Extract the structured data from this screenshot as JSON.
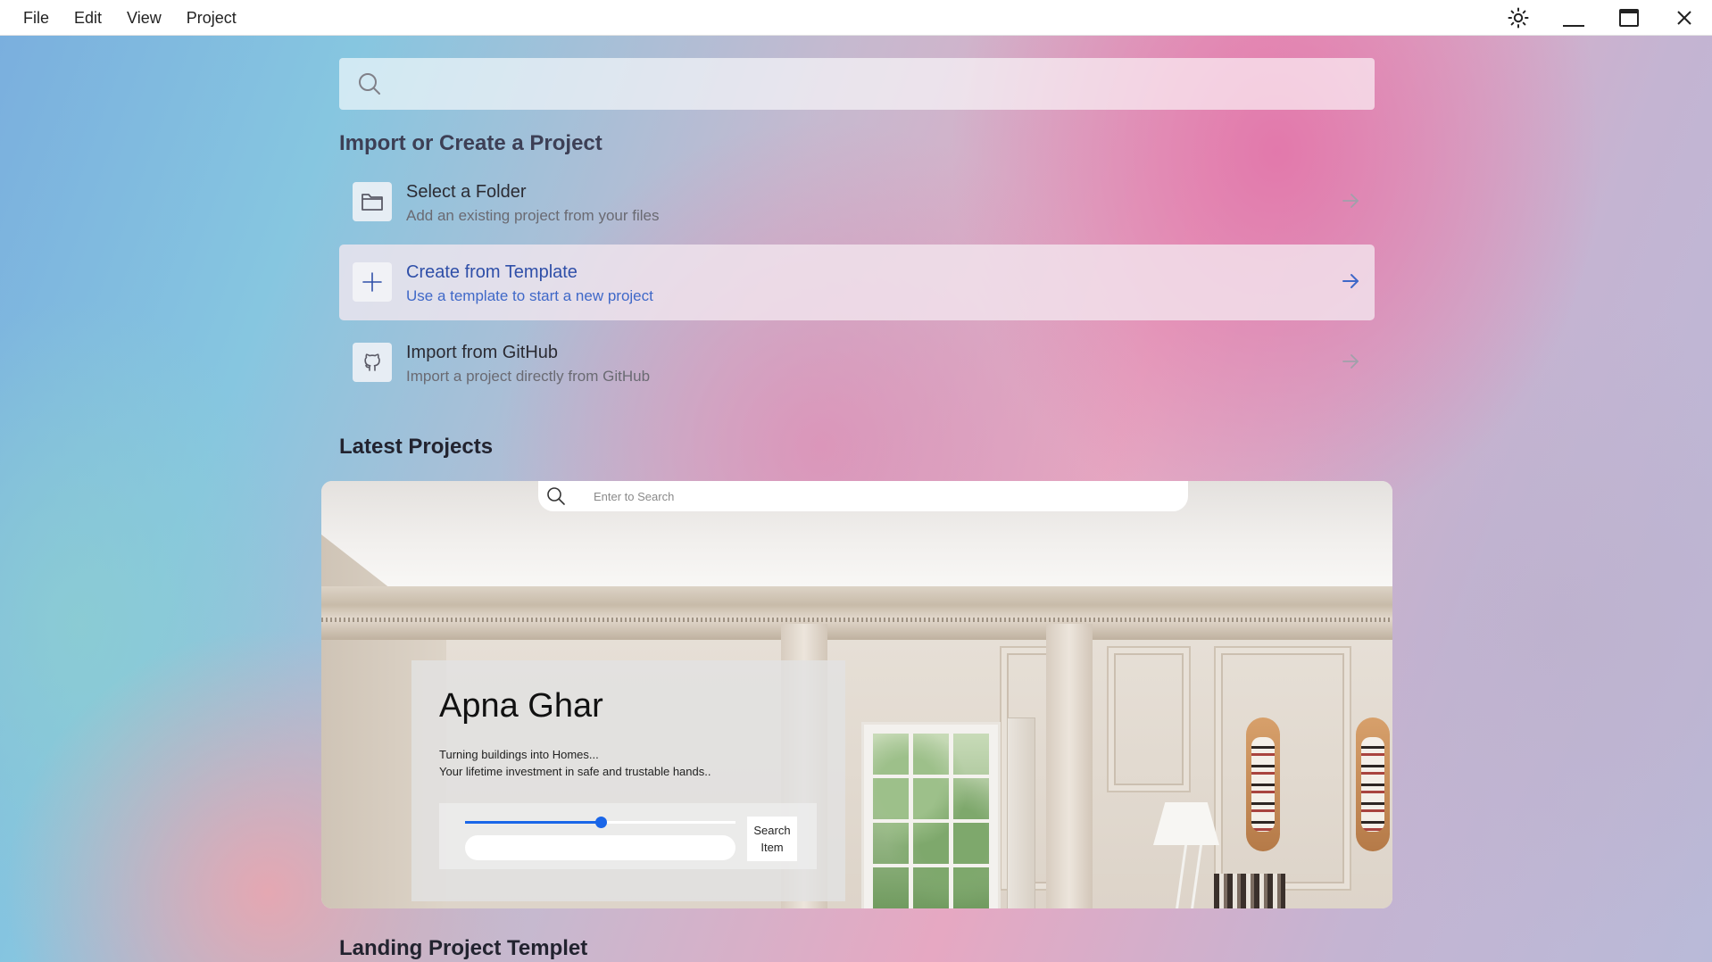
{
  "menu": {
    "items": [
      "File",
      "Edit",
      "View",
      "Project"
    ]
  },
  "window_controls": {
    "theme_icon": "sun-icon",
    "minimize_icon": "minimize-icon",
    "maximize_icon": "maximize-icon",
    "close_icon": "close-icon"
  },
  "search": {
    "placeholder": "",
    "value": ""
  },
  "import_section": {
    "title": "Import or Create a Project",
    "options": [
      {
        "title": "Select a Folder",
        "subtitle": "Add an existing project from your files",
        "icon": "folder-icon"
      },
      {
        "title": "Create from Template",
        "subtitle": "Use a template to start a new project",
        "icon": "plus-icon"
      },
      {
        "title": "Import from GitHub",
        "subtitle": "Import a project directly from GitHub",
        "icon": "github-icon"
      }
    ]
  },
  "latest_projects": {
    "title": "Latest Projects",
    "card": {
      "search_placeholder": "Enter to Search",
      "hero_title": "Apna Ghar",
      "hero_line_1": "Turning buildings into Homes...",
      "hero_line_2": "Your lifetime investment in safe and trustable hands..",
      "slider_value": 0.5,
      "search_button": "Search Item"
    }
  },
  "next_section": {
    "title": "Landing Project Templet"
  },
  "colors": {
    "accent": "#1a66e8",
    "active_option_title": "#2f4fa8"
  }
}
